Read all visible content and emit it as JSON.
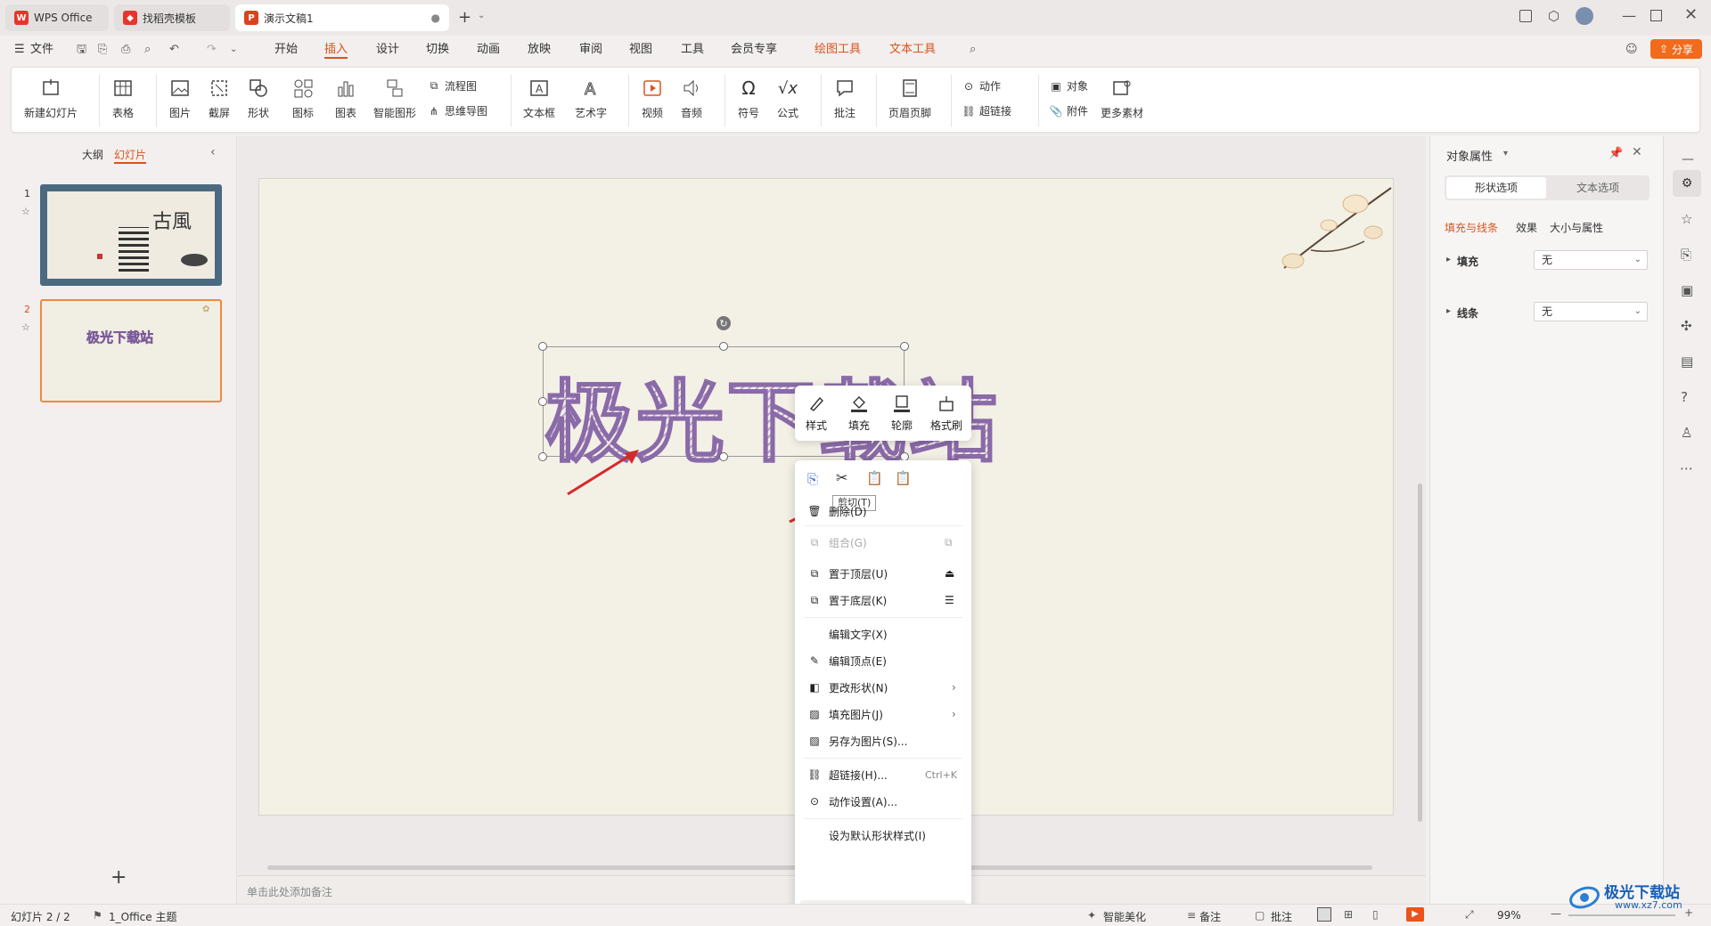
{
  "tabs": [
    {
      "label": "WPS Office",
      "icon": "wps-logo-icon"
    },
    {
      "label": "找稻壳模板",
      "icon": "docer-icon"
    },
    {
      "label": "演示文稿1",
      "icon": "presentation-icon"
    }
  ],
  "file_menu": "文件",
  "menu": [
    "开始",
    "插入",
    "设计",
    "切换",
    "动画",
    "放映",
    "审阅",
    "视图",
    "工具",
    "会员专享"
  ],
  "context_tabs": [
    "绘图工具",
    "文本工具"
  ],
  "share_label": "分享",
  "ribbon": {
    "new_slide": "新建幻灯片",
    "table": "表格",
    "picture": "图片",
    "screenshot": "截屏",
    "shape": "形状",
    "icon_lib": "图标",
    "chart": "图表",
    "smartart": "智能图形",
    "flowchart": "流程图",
    "mindmap": "思维导图",
    "textbox": "文本框",
    "wordart": "艺术字",
    "video": "视频",
    "audio": "音频",
    "symbol": "符号",
    "formula": "公式",
    "comment": "批注",
    "header_footer": "页眉页脚",
    "action": "动作",
    "hyperlink": "超链接",
    "object": "对象",
    "attachment": "附件",
    "more": "更多素材"
  },
  "left_panel": {
    "outline_tab": "大纲",
    "slides_tab": "幻灯片",
    "slide_numbers": [
      "1",
      "2"
    ],
    "thumb1_title": "古風",
    "thumb2_title": "极光下载站"
  },
  "slide": {
    "wordart_text": "极光下载站"
  },
  "mini_toolbar": [
    "样式",
    "填充",
    "轮廓",
    "格式刷"
  ],
  "tooltip": "剪切(T)",
  "context_menu": [
    {
      "label": "删除(D)",
      "disabled": false
    },
    {
      "label": "组合(G)",
      "disabled": true
    },
    {
      "label": "置于顶层(U)",
      "disabled": false
    },
    {
      "label": "置于底层(K)",
      "disabled": false
    },
    {
      "label": "编辑文字(X)",
      "disabled": false
    },
    {
      "label": "编辑顶点(E)",
      "disabled": false
    },
    {
      "label": "更改形状(N)",
      "disabled": false
    },
    {
      "label": "填充图片(J)",
      "disabled": false
    },
    {
      "label": "另存为图片(S)...",
      "disabled": false
    },
    {
      "label": "超链接(H)...",
      "shortcut": "Ctrl+K",
      "disabled": false
    },
    {
      "label": "动作设置(A)...",
      "disabled": false
    },
    {
      "label": "设为默认形状样式(I)",
      "disabled": false
    }
  ],
  "notes_placeholder": "单击此处添加备注",
  "right_panel": {
    "title": "对象属性",
    "tab_shape": "形状选项",
    "tab_text": "文本选项",
    "subtab_fill": "填充与线条",
    "subtab_effect": "效果",
    "subtab_size": "大小与属性",
    "fill_label": "填充",
    "fill_value": "无",
    "line_label": "线条",
    "line_value": "无"
  },
  "status": {
    "slide_info": "幻灯片 2 / 2",
    "theme": "1_Office 主题",
    "beautify": "智能美化",
    "notes": "备注",
    "comments": "批注",
    "zoom": "99%"
  },
  "colors": {
    "accent": "#d9531e",
    "wordart": "#8a6aa8",
    "slide_bg": "#f3f0e6"
  },
  "watermark": "极光下载站",
  "watermark_url": "www.xz7.com"
}
